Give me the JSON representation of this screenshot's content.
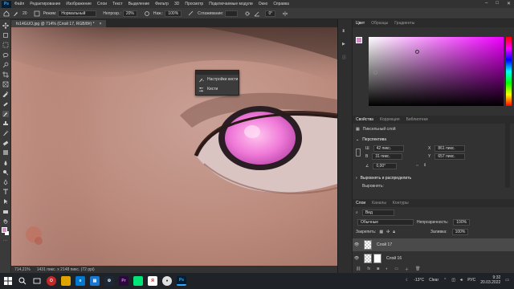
{
  "menubar": {
    "logo": "Ps",
    "items": [
      "Файл",
      "Редактирование",
      "Изображение",
      "Слои",
      "Текст",
      "Выделение",
      "Фильтр",
      "3D",
      "Просмотр",
      "Подключаемые модули",
      "Окно",
      "Справка"
    ]
  },
  "options": {
    "brush_size": "20",
    "mode_label": "Режим:",
    "mode_value": "Нормальный",
    "opacity_label": "Непрозр.:",
    "opacity_value": "20%",
    "pressure_label": "Наж.:",
    "pressure_value": "100%",
    "smoothing_label": "Сглаживание:",
    "angle_value": "0°"
  },
  "document_tab": {
    "title": "fo14GUO.jpg @ 714% (Слой 17, RGB/8#) *"
  },
  "status": {
    "zoom": "714,21%",
    "dimensions": "1431 пикс. x 2148 пикс. (72 ppi)"
  },
  "brush_popup": {
    "settings_label": "Настройки кисти",
    "brushes_label": "Кисти"
  },
  "color_panel": {
    "tabs": [
      "Цвет",
      "Образцы",
      "Градиенты"
    ],
    "hue_color": "#f000ff"
  },
  "properties_panel": {
    "tabs": [
      "Свойства",
      "Коррекция",
      "Библиотеки"
    ],
    "layer_type": "Пиксельный слой",
    "transform_title": "Перспектива",
    "w_label": "Ш",
    "w_value": "42 пикс.",
    "h_label": "В",
    "h_value": "31 пикс.",
    "x_label": "X",
    "x_value": "861 пикс.",
    "y_label": "Y",
    "y_value": "657 пикс.",
    "angle_value": "0,00°",
    "align_title": "Выровнять и распределить",
    "align_sub": "Выровнять:"
  },
  "layers_panel": {
    "tabs": [
      "Слои",
      "Каналы",
      "Контуры"
    ],
    "filter_value": "Вид",
    "blend_mode": "Обычные",
    "opacity_label": "Непрозрачность:",
    "opacity_value": "100%",
    "lock_label": "Закрепить:",
    "fill_label": "Заливка:",
    "fill_value": "100%",
    "layers": [
      {
        "name": "Слой 17"
      },
      {
        "name": "Слой 16"
      }
    ]
  },
  "taskbar": {
    "weather_temp": "-13°C",
    "weather_text": "Clear",
    "lang": "РУС",
    "time": "9:32",
    "date": "20.03.2022",
    "apps": [
      "Ps",
      "Pr"
    ]
  }
}
